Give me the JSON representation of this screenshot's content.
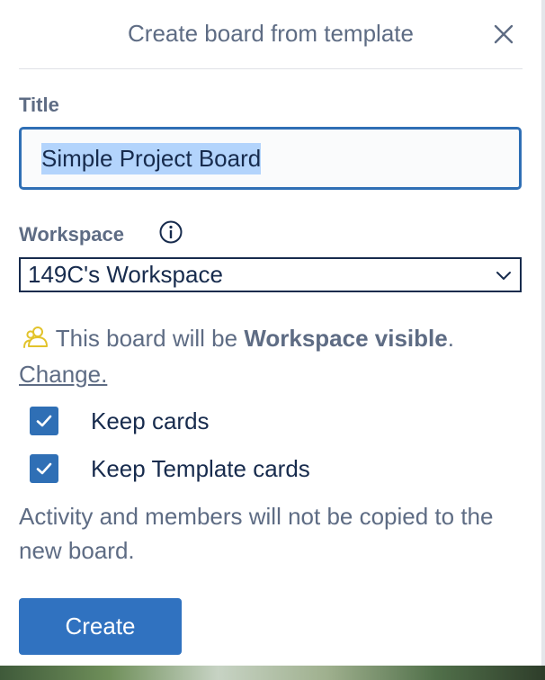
{
  "dialog": {
    "title": "Create board from template",
    "close_icon": "close-icon"
  },
  "form": {
    "title_label": "Title",
    "title_value": "Simple Project Board",
    "workspace_label": "Workspace",
    "info_icon": "info-icon",
    "workspace_selected": "149C's Workspace",
    "visibility_prefix": "This board will be",
    "visibility_value": "Workspace visible",
    "visibility_suffix": ".",
    "change_link": "Change.",
    "visibility_icon": "workspace-visible-icon",
    "keep_cards_label": "Keep cards",
    "keep_cards_checked": true,
    "keep_template_cards_label": "Keep Template cards",
    "keep_template_cards_checked": true,
    "note": "Activity and members will not be copied to the new board.",
    "create_button": "Create"
  },
  "colors": {
    "accent": "#3072c0",
    "input_border": "#2f6fb5",
    "selection": "#b3d4fc",
    "visibility_icon": "#e2c32b",
    "muted_text": "#5e6c84",
    "dark_text": "#172b4d"
  }
}
